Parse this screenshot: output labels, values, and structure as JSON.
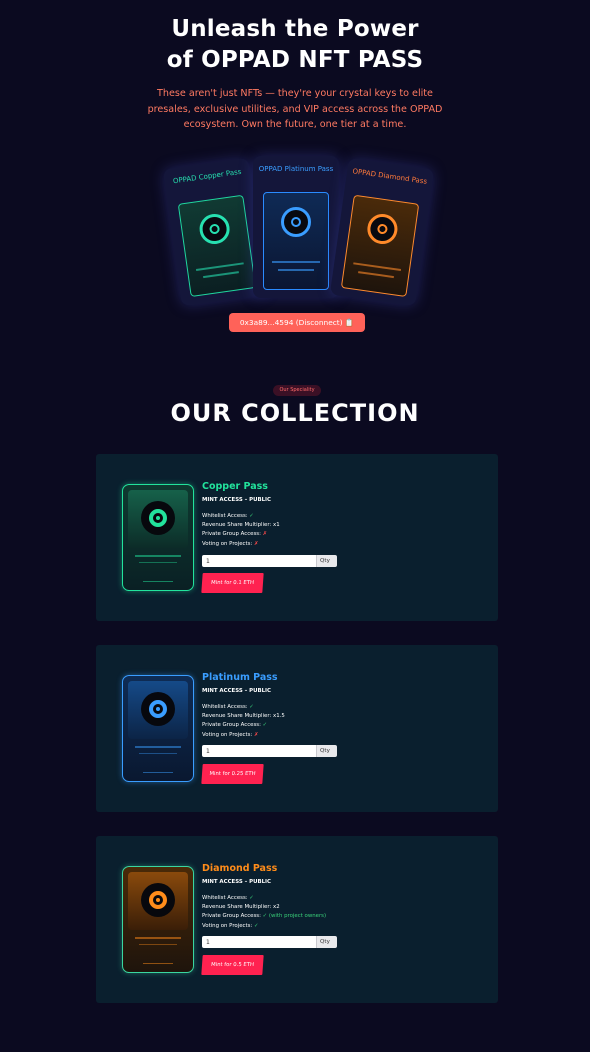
{
  "hero": {
    "title_line1": "Unleash the Power",
    "title_line2": "of OPPAD NFT PASS",
    "description": "These aren't just NFTs — they're your crystal keys to elite presales, exclusive utilities, and VIP access across the OPPAD ecosystem. Own the future, one tier at a time."
  },
  "showcase": [
    {
      "title": "OPPAD Copper Pass",
      "color": "#27e0b0"
    },
    {
      "title": "OPPAD Platinum Pass",
      "color": "#3a9dff"
    },
    {
      "title": "OPPAD Diamond Pass",
      "color": "#ff7a3a"
    }
  ],
  "wallet": {
    "label": "0x3a89...4594 (Disconnect) 📋"
  },
  "section": {
    "badge": "Our Speciality",
    "title": "OUR COLLECTION"
  },
  "passes": [
    {
      "name": "Copper Pass",
      "color": "#22e39c",
      "mint_access": "MINT ACCESS – PUBLIC",
      "features": [
        {
          "label": "Whitelist Access:",
          "value": "✓",
          "ok": true
        },
        {
          "label": "Revenue Share Multiplier: x1",
          "value": "",
          "ok": true
        },
        {
          "label": "Private Group Access:",
          "value": "✗",
          "ok": false
        },
        {
          "label": "Voting on Projects:",
          "value": "✗",
          "ok": false
        }
      ],
      "qty_value": "1",
      "qty_label": "Qty",
      "mint_label": "Mint for 0.1 ETH"
    },
    {
      "name": "Platinum Pass",
      "color": "#3a9dff",
      "mint_access": "MINT ACCESS – PUBLIC",
      "features": [
        {
          "label": "Whitelist Access:",
          "value": "✓",
          "ok": true
        },
        {
          "label": "Revenue Share Multiplier: x1.5",
          "value": "",
          "ok": true
        },
        {
          "label": "Private Group Access:",
          "value": "✓",
          "ok": true
        },
        {
          "label": "Voting on Projects:",
          "value": "✗",
          "ok": false
        }
      ],
      "qty_value": "1",
      "qty_label": "Qty",
      "mint_label": "Mint for 0.25 ETH"
    },
    {
      "name": "Diamond Pass",
      "color": "#ff8c1a",
      "mint_access": "MINT ACCESS – PUBLIC",
      "features": [
        {
          "label": "Whitelist Access:",
          "value": "✓",
          "ok": true
        },
        {
          "label": "Revenue Share Multiplier: x2",
          "value": "",
          "ok": true
        },
        {
          "label": "Private Group Access:",
          "value": "✓ (with project owners)",
          "ok": true
        },
        {
          "label": "Voting on Projects:",
          "value": "✓",
          "ok": true
        }
      ],
      "qty_value": "1",
      "qty_label": "Qty",
      "mint_label": "Mint for 0.5 ETH"
    }
  ]
}
